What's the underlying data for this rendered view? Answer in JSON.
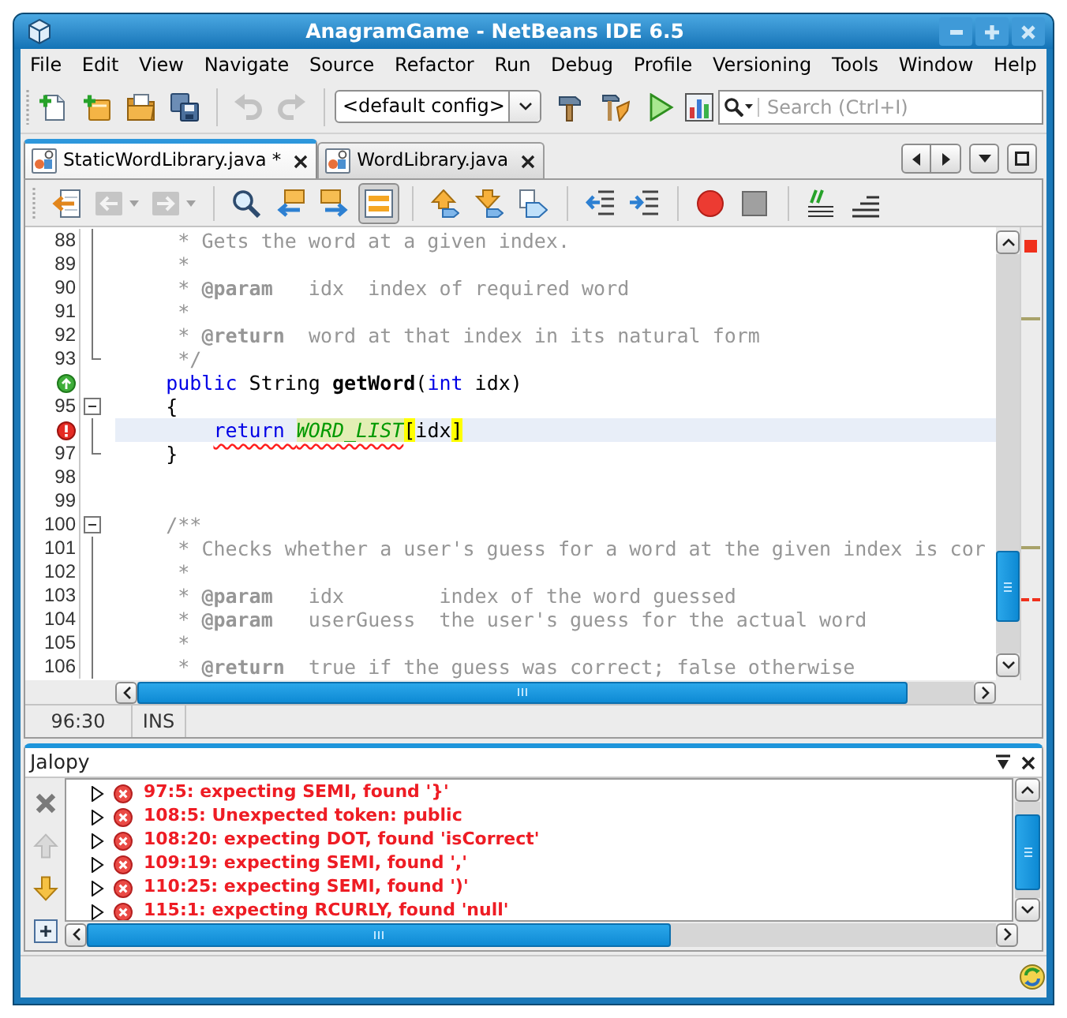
{
  "window": {
    "title": "AnagramGame - NetBeans IDE 6.5"
  },
  "menu": [
    "File",
    "Edit",
    "View",
    "Navigate",
    "Source",
    "Refactor",
    "Run",
    "Debug",
    "Profile",
    "Versioning",
    "Tools",
    "Window",
    "Help"
  ],
  "toolbar": [
    {
      "kind": "new_file",
      "disabled": false
    },
    {
      "kind": "new_project",
      "disabled": false
    },
    {
      "kind": "open_project",
      "disabled": false
    },
    {
      "kind": "save_all",
      "disabled": false
    },
    {
      "kind": "separator"
    },
    {
      "kind": "undo",
      "disabled": true
    },
    {
      "kind": "redo",
      "disabled": true
    },
    {
      "kind": "separator"
    },
    {
      "kind": "config",
      "value": "<default config>"
    },
    {
      "kind": "build",
      "disabled": false
    },
    {
      "kind": "clean_build",
      "disabled": false
    },
    {
      "kind": "run",
      "disabled": false
    },
    {
      "kind": "profile",
      "disabled": false
    },
    {
      "kind": "search",
      "placeholder": "Search (Ctrl+I)"
    }
  ],
  "editor_tabs": [
    {
      "label": "StaticWordLibrary.java *",
      "selected": true
    },
    {
      "label": "WordLibrary.java",
      "selected": false
    }
  ],
  "editor_toolbar": [
    {
      "kind": "last_edit",
      "disabled": false,
      "pressed": false
    },
    {
      "kind": "back",
      "disabled": true,
      "pressed": false
    },
    {
      "kind": "forward",
      "disabled": true,
      "pressed": false
    },
    {
      "kind": "separator"
    },
    {
      "kind": "find",
      "disabled": false,
      "pressed": false
    },
    {
      "kind": "find_previous",
      "disabled": false,
      "pressed": false
    },
    {
      "kind": "find_next",
      "disabled": false,
      "pressed": false
    },
    {
      "kind": "toggle_highlight",
      "disabled": false,
      "pressed": true
    },
    {
      "kind": "separator"
    },
    {
      "kind": "previous_bookmark",
      "disabled": false,
      "pressed": false
    },
    {
      "kind": "next_bookmark",
      "disabled": false,
      "pressed": false
    },
    {
      "kind": "toggle_bookmark",
      "disabled": false,
      "pressed": false
    },
    {
      "kind": "separator"
    },
    {
      "kind": "shift_left",
      "disabled": false,
      "pressed": false
    },
    {
      "kind": "shift_right",
      "disabled": false,
      "pressed": false
    },
    {
      "kind": "separator"
    },
    {
      "kind": "record_macro",
      "disabled": false,
      "pressed": false
    },
    {
      "kind": "stop_macro",
      "disabled": false,
      "pressed": false
    },
    {
      "kind": "separator"
    },
    {
      "kind": "comment",
      "disabled": false,
      "pressed": false
    },
    {
      "kind": "uncomment",
      "disabled": false,
      "pressed": false
    }
  ],
  "editor": {
    "lines": [
      {
        "number": "88",
        "fold": {
          "kind": "body"
        },
        "current": false,
        "tokens": [
          {
            "text": "     * Gets the word at a given index.",
            "kind": "comment"
          }
        ]
      },
      {
        "number": "89",
        "fold": {
          "kind": "body"
        },
        "current": false,
        "tokens": [
          {
            "text": "     *",
            "kind": "comment"
          }
        ]
      },
      {
        "number": "90",
        "fold": {
          "kind": "body"
        },
        "current": false,
        "tokens": [
          {
            "text": "     * ",
            "kind": "comment"
          },
          {
            "text": "@param",
            "kind": "tag"
          },
          {
            "text": "   idx  index of required word",
            "kind": "comment"
          }
        ]
      },
      {
        "number": "91",
        "fold": {
          "kind": "body"
        },
        "current": false,
        "tokens": [
          {
            "text": "     *",
            "kind": "comment"
          }
        ]
      },
      {
        "number": "92",
        "fold": {
          "kind": "body"
        },
        "current": false,
        "tokens": [
          {
            "text": "     * ",
            "kind": "comment"
          },
          {
            "text": "@return",
            "kind": "tag"
          },
          {
            "text": "  word at that index in its natural form",
            "kind": "comment"
          }
        ]
      },
      {
        "number": "93",
        "fold": {
          "kind": "end"
        },
        "current": false,
        "tokens": [
          {
            "text": "     */",
            "kind": "comment"
          }
        ]
      },
      {
        "marker": {
          "kind": "override"
        },
        "current": false,
        "tokens": [
          {
            "text": "    public",
            "kind": "keyword"
          },
          {
            "text": " String ",
            "kind": "plain"
          },
          {
            "text": "getWord",
            "kind": "method"
          },
          {
            "text": "(",
            "kind": "plain"
          },
          {
            "text": "int",
            "kind": "keyword"
          },
          {
            "text": " idx)",
            "kind": "plain"
          }
        ]
      },
      {
        "number": "95",
        "fold": {
          "kind": "start",
          "expanded": true
        },
        "current": false,
        "tokens": [
          {
            "text": "    {",
            "kind": "plain"
          }
        ]
      },
      {
        "marker": {
          "kind": "error"
        },
        "fold": {
          "kind": "body"
        },
        "current": true,
        "tokens": [
          {
            "kind": "error",
            "children": [
              {
                "text": "        return ",
                "kind": "keyword"
              },
              {
                "text": "WORD_LIST",
                "kind": "occurrence"
              }
            ]
          },
          {
            "text": "[",
            "kind": "bracket"
          },
          {
            "text": "idx",
            "kind": "plain"
          },
          {
            "text": "]",
            "kind": "bracket"
          }
        ]
      },
      {
        "number": "97",
        "fold": {
          "kind": "end"
        },
        "current": false,
        "tokens": [
          {
            "text": "    }",
            "kind": "plain"
          }
        ]
      },
      {
        "number": "98",
        "current": false
      },
      {
        "number": "99",
        "current": false
      },
      {
        "number": "100",
        "fold": {
          "kind": "start",
          "expanded": true
        },
        "current": false,
        "tokens": [
          {
            "text": "    /**",
            "kind": "comment"
          }
        ]
      },
      {
        "number": "101",
        "fold": {
          "kind": "body"
        },
        "current": false,
        "tokens": [
          {
            "text": "     * Checks whether a user's guess for a word at the given index is cor",
            "kind": "comment"
          }
        ]
      },
      {
        "number": "102",
        "fold": {
          "kind": "body"
        },
        "current": false,
        "tokens": [
          {
            "text": "     *",
            "kind": "comment"
          }
        ]
      },
      {
        "number": "103",
        "fold": {
          "kind": "body"
        },
        "current": false,
        "tokens": [
          {
            "text": "     * ",
            "kind": "comment"
          },
          {
            "text": "@param",
            "kind": "tag"
          },
          {
            "text": "   idx        index of the word guessed",
            "kind": "comment"
          }
        ]
      },
      {
        "number": "104",
        "fold": {
          "kind": "body"
        },
        "current": false,
        "tokens": [
          {
            "text": "     * ",
            "kind": "comment"
          },
          {
            "text": "@param",
            "kind": "tag"
          },
          {
            "text": "   userGuess  the user's guess for the actual word",
            "kind": "comment"
          }
        ]
      },
      {
        "number": "105",
        "fold": {
          "kind": "body"
        },
        "current": false,
        "tokens": [
          {
            "text": "     *",
            "kind": "comment"
          }
        ]
      },
      {
        "number": "106",
        "fold": {
          "kind": "body"
        },
        "current": false,
        "tokens": [
          {
            "text": "     * ",
            "kind": "comment"
          },
          {
            "text": "@return",
            "kind": "tag"
          },
          {
            "text": "  true if the guess was correct; false otherwise",
            "kind": "comment"
          }
        ]
      }
    ]
  },
  "status_bar": {
    "position": "96:30",
    "mode": "INS"
  },
  "output": {
    "title": "Jalopy",
    "tools": [
      {
        "kind": "clear",
        "disabled": false
      },
      {
        "kind": "previous",
        "disabled": true
      },
      {
        "kind": "next",
        "disabled": false
      },
      {
        "kind": "expand",
        "disabled": false
      }
    ],
    "messages": [
      {
        "text": "97:5: expecting SEMI, found '}'",
        "kind": "error",
        "expanded": false
      },
      {
        "text": "108:5: Unexpected token: public",
        "kind": "error",
        "expanded": false
      },
      {
        "text": "108:20: expecting DOT, found 'isCorrect'",
        "kind": "error",
        "expanded": false
      },
      {
        "text": "109:19: expecting SEMI, found ','",
        "kind": "error",
        "expanded": false
      },
      {
        "text": "110:25: expecting SEMI, found ')'",
        "kind": "error",
        "expanded": false
      },
      {
        "text": "115:1: expecting RCURLY, found 'null'",
        "kind": "error",
        "expanded": false
      }
    ]
  }
}
